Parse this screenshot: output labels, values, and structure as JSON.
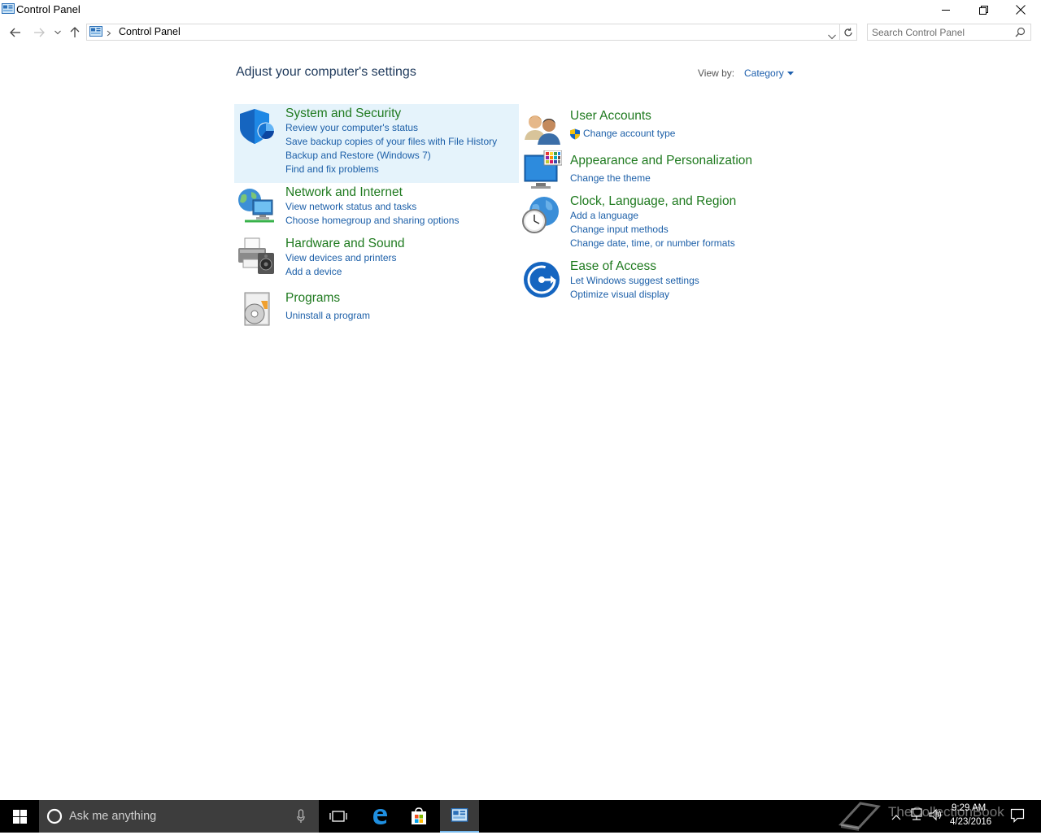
{
  "window": {
    "title": "Control Panel"
  },
  "nav": {
    "breadcrumb": "Control Panel",
    "search_placeholder": "Search Control Panel"
  },
  "content": {
    "heading": "Adjust your computer's settings",
    "view_by_label": "View by:",
    "view_by_value": "Category"
  },
  "categories": {
    "system_security": {
      "title": "System and Security",
      "links": [
        "Review your computer's status",
        "Save backup copies of your files with File History",
        "Backup and Restore (Windows 7)",
        "Find and fix problems"
      ]
    },
    "network_internet": {
      "title": "Network and Internet",
      "links": [
        "View network status and tasks",
        "Choose homegroup and sharing options"
      ]
    },
    "hardware_sound": {
      "title": "Hardware and Sound",
      "links": [
        "View devices and printers",
        "Add a device"
      ]
    },
    "programs": {
      "title": "Programs",
      "links": [
        "Uninstall a program"
      ]
    },
    "user_accounts": {
      "title": "User Accounts",
      "links": [
        "Change account type"
      ]
    },
    "appearance": {
      "title": "Appearance and Personalization",
      "links": [
        "Change the theme"
      ]
    },
    "clock_region": {
      "title": "Clock, Language, and Region",
      "links": [
        "Add a language",
        "Change input methods",
        "Change date, time, or number formats"
      ]
    },
    "ease_access": {
      "title": "Ease of Access",
      "links": [
        "Let Windows suggest settings",
        "Optimize visual display"
      ]
    }
  },
  "taskbar": {
    "search_placeholder": "Ask me anything",
    "time": "9:29 AM",
    "date": "4/23/2016",
    "watermark": "TheCollectionBook"
  },
  "colors": {
    "link": "#1c5fa8",
    "category_title": "#1f7a1f",
    "heading": "#1e395b",
    "hover_bg": "#e5f3fb",
    "taskbar": "#000000"
  }
}
